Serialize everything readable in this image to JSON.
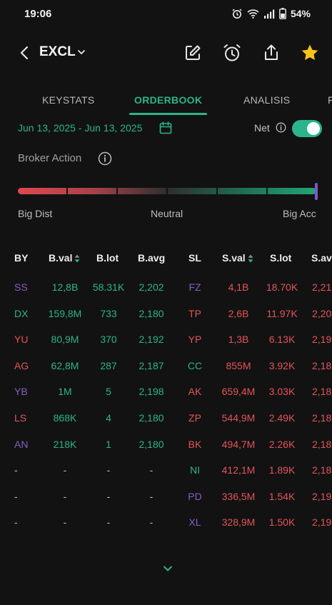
{
  "status_bar": {
    "time": "19:06",
    "battery": "54%"
  },
  "header": {
    "ticker": "EXCL"
  },
  "tabs": [
    {
      "label": "KEYSTATS",
      "active": false
    },
    {
      "label": "ORDERBOOK",
      "active": true
    },
    {
      "label": "ANALISIS",
      "active": false
    },
    {
      "label": "F",
      "active": false
    }
  ],
  "filters": {
    "date_range": "Jun 13, 2025 - Jun 13, 2025",
    "net_label": "Net",
    "net_enabled": true
  },
  "broker_action": {
    "title": "Broker Action",
    "labels": {
      "left": "Big Dist",
      "center": "Neutral",
      "right": "Big Acc"
    },
    "level": 1.0
  },
  "table": {
    "headers": [
      "BY",
      "B.val",
      "B.lot",
      "B.avg",
      "SL",
      "S.val",
      "S.lot",
      "S.av"
    ],
    "rows": [
      {
        "by": "SS",
        "by_color": "purple",
        "bval": "12,8B",
        "blot": "58.31K",
        "bavg": "2,202",
        "sl": "FZ",
        "sl_color": "purple",
        "sval": "4,1B",
        "slot": "18.70K",
        "savg": "2,21"
      },
      {
        "by": "DX",
        "by_color": "green",
        "bval": "159,8M",
        "blot": "733",
        "bavg": "2,180",
        "sl": "TP",
        "sl_color": "red",
        "sval": "2,6B",
        "slot": "11.97K",
        "savg": "2,20"
      },
      {
        "by": "YU",
        "by_color": "red",
        "bval": "80,9M",
        "blot": "370",
        "bavg": "2,192",
        "sl": "YP",
        "sl_color": "red",
        "sval": "1,3B",
        "slot": "6.13K",
        "savg": "2,19"
      },
      {
        "by": "AG",
        "by_color": "red",
        "bval": "62,8M",
        "blot": "287",
        "bavg": "2,187",
        "sl": "CC",
        "sl_color": "green",
        "sval": "855M",
        "slot": "3.92K",
        "savg": "2,18"
      },
      {
        "by": "YB",
        "by_color": "purple",
        "bval": "1M",
        "blot": "5",
        "bavg": "2,198",
        "sl": "AK",
        "sl_color": "red",
        "sval": "659,4M",
        "slot": "3.03K",
        "savg": "2,18"
      },
      {
        "by": "LS",
        "by_color": "red",
        "bval": "868K",
        "blot": "4",
        "bavg": "2,180",
        "sl": "ZP",
        "sl_color": "red",
        "sval": "544,9M",
        "slot": "2.49K",
        "savg": "2,18"
      },
      {
        "by": "AN",
        "by_color": "purple",
        "bval": "218K",
        "blot": "1",
        "bavg": "2,180",
        "sl": "BK",
        "sl_color": "red",
        "sval": "494,7M",
        "slot": "2.26K",
        "savg": "2,18"
      },
      {
        "by": "-",
        "by_color": "dash",
        "bval": "-",
        "blot": "-",
        "bavg": "-",
        "sl": "NI",
        "sl_color": "green",
        "sval": "412,1M",
        "slot": "1.89K",
        "savg": "2,18"
      },
      {
        "by": "-",
        "by_color": "dash",
        "bval": "-",
        "blot": "-",
        "bavg": "-",
        "sl": "PD",
        "sl_color": "purple",
        "sval": "336,5M",
        "slot": "1.54K",
        "savg": "2,19"
      },
      {
        "by": "-",
        "by_color": "dash",
        "bval": "-",
        "blot": "-",
        "bavg": "-",
        "sl": "XL",
        "sl_color": "purple",
        "sval": "328,9M",
        "slot": "1.50K",
        "savg": "2,19"
      }
    ]
  },
  "colors": {
    "accent": "#2bb58a",
    "sell": "#e4545a",
    "foreign": "#8b5cc8",
    "background": "#121212"
  }
}
